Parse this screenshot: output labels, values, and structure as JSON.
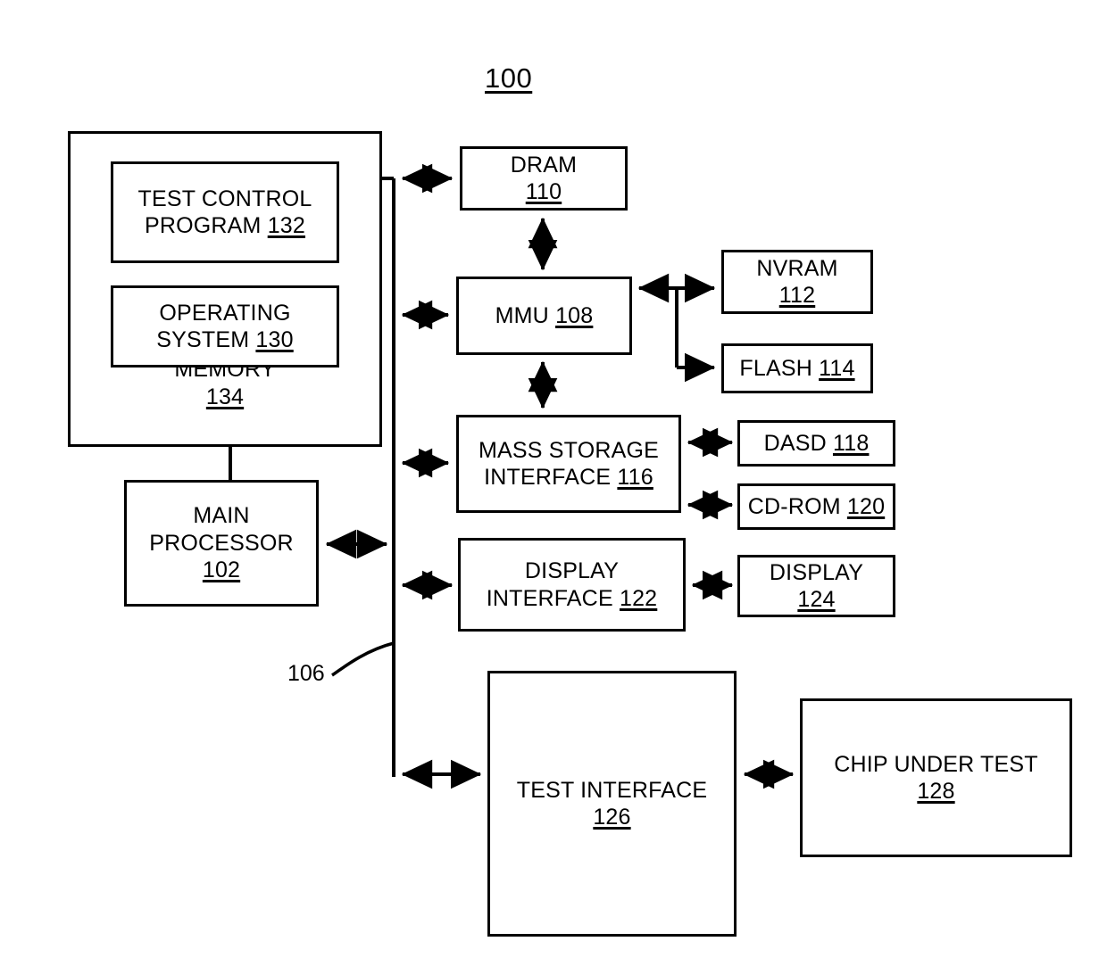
{
  "figure": {
    "number": "100"
  },
  "bus": {
    "label": "106",
    "name": "system-bus"
  },
  "blocks": {
    "memory": {
      "title": "MEMORY",
      "ref": "134"
    },
    "test_control_program": {
      "title": "TEST CONTROL\nPROGRAM ",
      "ref": "132"
    },
    "operating_system": {
      "title": "OPERATING\nSYSTEM ",
      "ref": "130"
    },
    "main_processor": {
      "title": "MAIN\nPROCESSOR\n",
      "ref": "102"
    },
    "dram": {
      "title": "DRAM\n",
      "ref": "110"
    },
    "mmu": {
      "title": "MMU ",
      "ref": "108"
    },
    "nvram": {
      "title": "NVRAM\n",
      "ref": "112"
    },
    "flash": {
      "title": "FLASH ",
      "ref": "114"
    },
    "mass_storage_interface": {
      "title": "MASS STORAGE\nINTERFACE ",
      "ref": "116"
    },
    "dasd": {
      "title": "DASD ",
      "ref": "118"
    },
    "cdrom": {
      "title": "CD-ROM ",
      "ref": "120"
    },
    "display_interface": {
      "title": "DISPLAY\nINTERFACE ",
      "ref": "122"
    },
    "display": {
      "title": "DISPLAY\n",
      "ref": "124"
    },
    "test_interface": {
      "title": "TEST INTERFACE\n",
      "ref": "126"
    },
    "chip_under_test": {
      "title": "CHIP  UNDER TEST\n",
      "ref": "128"
    }
  },
  "colors": {
    "stroke": "#000000",
    "background": "#ffffff"
  }
}
